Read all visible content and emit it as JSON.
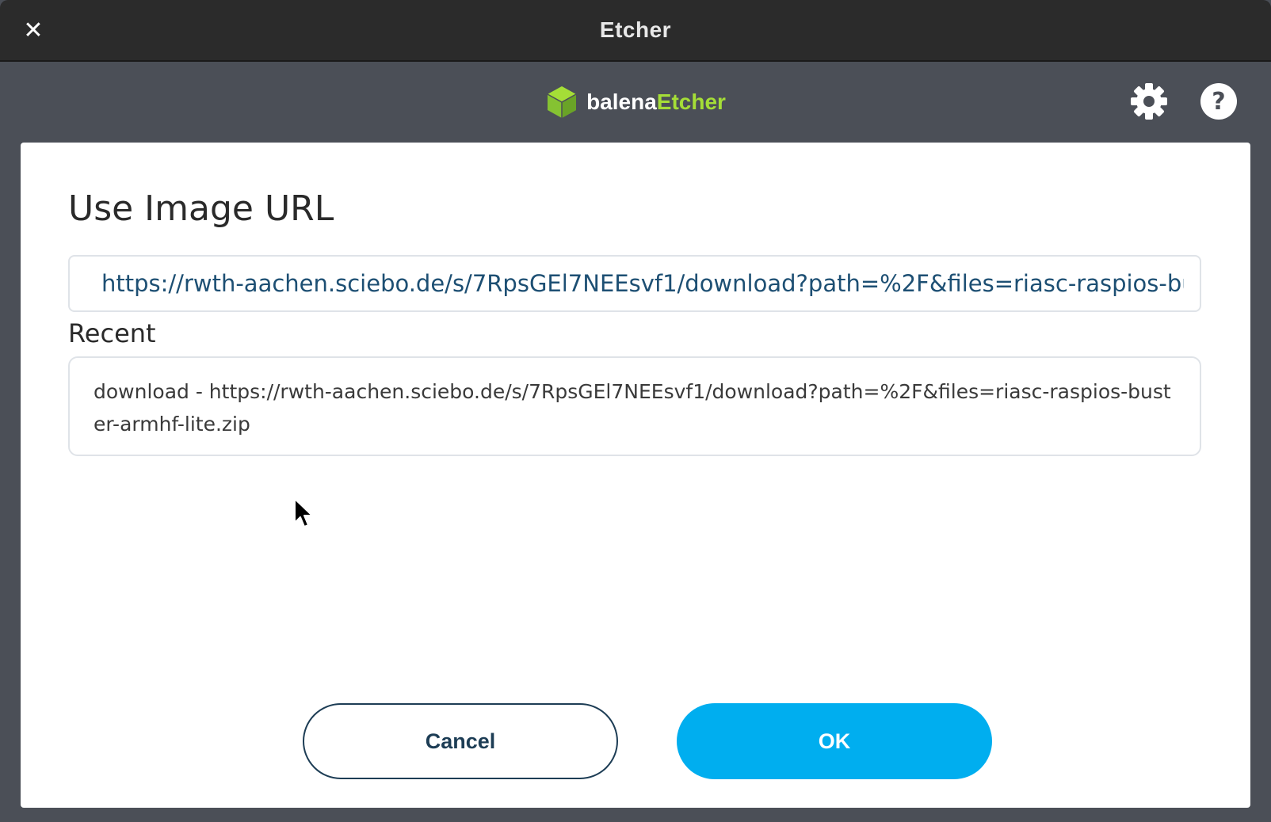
{
  "window": {
    "title": "Etcher",
    "close_glyph": "✕"
  },
  "header": {
    "logo_primary": "balena",
    "logo_accent": "Etcher",
    "logo_icon": "cube-icon",
    "accent_color": "#a5de37",
    "settings_icon": "gear-icon",
    "help_icon": "question-icon"
  },
  "dialog": {
    "title": "Use Image URL",
    "url_value": "https://rwth-aachen.sciebo.de/s/7RpsGEl7NEEsvf1/download?path=%2F&files=riasc-raspios-buster-armhf-lite.zip",
    "recent_label": "Recent",
    "recent_items": [
      "download - https://rwth-aachen.sciebo.de/s/7RpsGEl7NEEsvf1/download?path=%2F&files=riasc-raspios-buster-armhf-lite.zip"
    ],
    "cancel_label": "Cancel",
    "ok_label": "OK",
    "ok_color": "#00aeef"
  }
}
